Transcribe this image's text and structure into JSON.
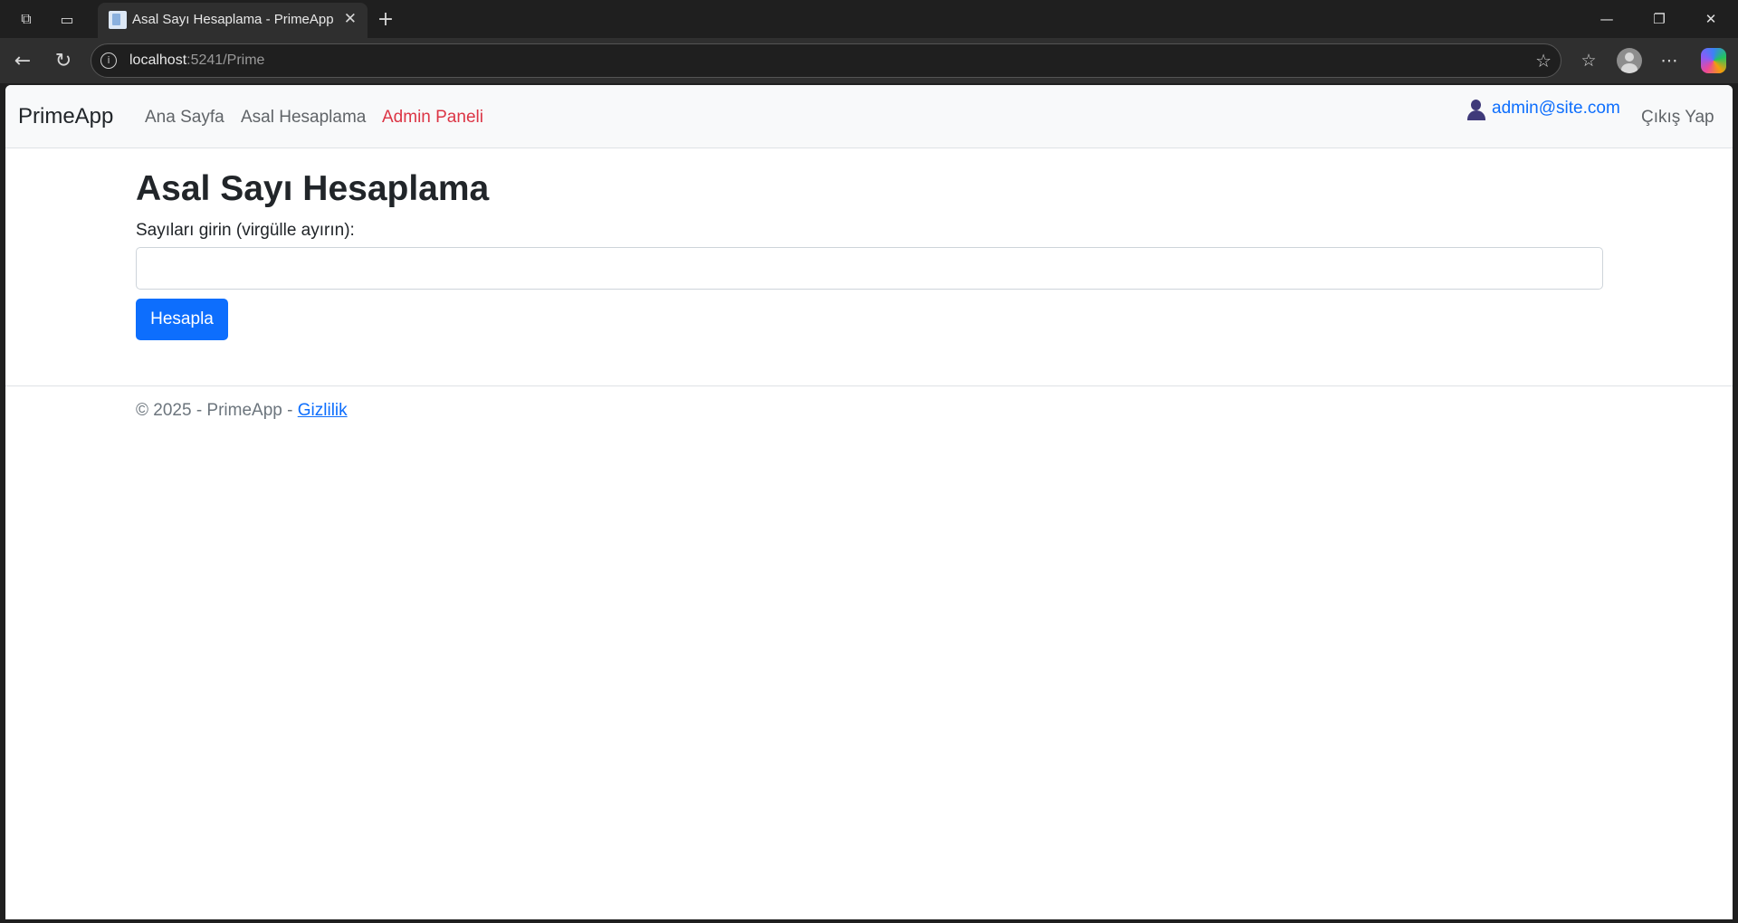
{
  "browser": {
    "tab_title": "Asal Sayı Hesaplama - PrimeApp",
    "url_host": "localhost",
    "url_rest": ":5241/Prime"
  },
  "navbar": {
    "brand": "PrimeApp",
    "links": [
      {
        "label": "Ana Sayfa"
      },
      {
        "label": "Asal Hesaplama"
      },
      {
        "label": "Admin Paneli",
        "color": "#dc3545"
      }
    ],
    "user_email": "admin@site.com",
    "logout": "Çıkış Yap"
  },
  "main": {
    "title": "Asal Sayı Hesaplama",
    "input_label": "Sayıları girin (virgülle ayırın):",
    "input_value": "",
    "button_label": "Hesapla",
    "button_color": "#0d6efd"
  },
  "footer": {
    "text": "© 2025 - PrimeApp - ",
    "link": "Gizlilik"
  },
  "icons": [
    "workspaces-icon",
    "tab-actions-icon",
    "close-icon",
    "new-tab-icon",
    "minimize-icon",
    "restore-icon",
    "back-icon",
    "reload-icon",
    "info-icon",
    "star-icon",
    "favorites-icon",
    "profile-icon",
    "more-icon",
    "copilot-icon",
    "user-icon"
  ]
}
